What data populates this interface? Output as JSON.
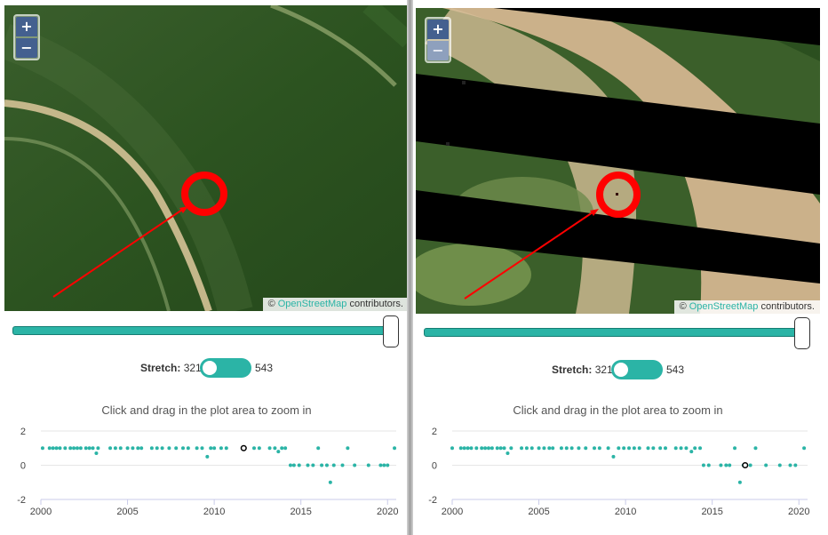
{
  "panels": [
    {
      "id": "left",
      "zoom_in": "+",
      "zoom_out": "−",
      "attribution": {
        "prefix": "© ",
        "link": "OpenStreetMap",
        "suffix": " contributors."
      },
      "stretch": {
        "label": "Stretch:",
        "min": "321",
        "max": "543"
      },
      "plot_title": "Click and drag in the plot area to zoom in",
      "chart_data": {
        "type": "scatter",
        "title": "",
        "xlabel": "",
        "ylabel": "",
        "xlim": [
          2000,
          2020.5
        ],
        "ylim": [
          -2,
          2
        ],
        "xticks": [
          "2000",
          "2005",
          "2010",
          "2015",
          "2020"
        ],
        "yticks": [
          "2",
          "0",
          "-2"
        ],
        "series": [
          {
            "color": "#2bb4a6",
            "points": [
              [
                2000.1,
                1
              ],
              [
                2000.5,
                1
              ],
              [
                2000.7,
                1
              ],
              [
                2000.9,
                1
              ],
              [
                2001.1,
                1
              ],
              [
                2001.4,
                1
              ],
              [
                2001.7,
                1
              ],
              [
                2001.9,
                1
              ],
              [
                2002.1,
                1
              ],
              [
                2002.3,
                1
              ],
              [
                2002.6,
                1
              ],
              [
                2002.8,
                1
              ],
              [
                2003.0,
                1
              ],
              [
                2003.2,
                0.7
              ],
              [
                2003.3,
                1
              ],
              [
                2004.0,
                1
              ],
              [
                2004.3,
                1
              ],
              [
                2004.6,
                1
              ],
              [
                2005.0,
                1
              ],
              [
                2005.3,
                1
              ],
              [
                2005.6,
                1
              ],
              [
                2005.8,
                1
              ],
              [
                2006.4,
                1
              ],
              [
                2006.7,
                1
              ],
              [
                2007.0,
                1
              ],
              [
                2007.4,
                1
              ],
              [
                2007.8,
                1
              ],
              [
                2008.2,
                1
              ],
              [
                2008.5,
                1
              ],
              [
                2009.0,
                1
              ],
              [
                2009.3,
                1
              ],
              [
                2009.6,
                0.5
              ],
              [
                2009.8,
                1
              ],
              [
                2010.0,
                1
              ],
              [
                2010.4,
                1
              ],
              [
                2010.7,
                1
              ],
              [
                2012.3,
                1
              ],
              [
                2012.6,
                1
              ],
              [
                2013.2,
                1
              ],
              [
                2013.5,
                1
              ],
              [
                2013.7,
                0.8
              ],
              [
                2013.9,
                1
              ],
              [
                2014.1,
                1
              ],
              [
                2014.4,
                0
              ],
              [
                2014.6,
                0
              ],
              [
                2014.9,
                0
              ],
              [
                2015.4,
                0
              ],
              [
                2015.7,
                0
              ],
              [
                2016.0,
                1
              ],
              [
                2016.2,
                0
              ],
              [
                2016.5,
                0
              ],
              [
                2016.7,
                -1
              ],
              [
                2016.9,
                0
              ],
              [
                2017.4,
                0
              ],
              [
                2017.7,
                1
              ],
              [
                2018.1,
                0
              ],
              [
                2018.9,
                0
              ],
              [
                2019.6,
                0
              ],
              [
                2019.8,
                0
              ],
              [
                2020.0,
                0
              ],
              [
                2020.4,
                1
              ]
            ]
          }
        ],
        "highlighted_point": [
          2011.7,
          1
        ]
      }
    },
    {
      "id": "right",
      "zoom_in": "+",
      "zoom_out": "−",
      "attribution": {
        "prefix": "© ",
        "link": "OpenStreetMap",
        "suffix": " contributors."
      },
      "stretch": {
        "label": "Stretch:",
        "min": "321",
        "max": "543"
      },
      "plot_title": "Click and drag in the plot area to zoom in",
      "chart_data": {
        "type": "scatter",
        "title": "",
        "xlabel": "",
        "ylabel": "",
        "xlim": [
          2000,
          2020.5
        ],
        "ylim": [
          -2,
          2
        ],
        "xticks": [
          "2000",
          "2005",
          "2010",
          "2015",
          "2020"
        ],
        "yticks": [
          "2",
          "0",
          "-2"
        ],
        "series": [
          {
            "color": "#2bb4a6",
            "points": [
              [
                2000.0,
                1
              ],
              [
                2000.5,
                1
              ],
              [
                2000.7,
                1
              ],
              [
                2000.9,
                1
              ],
              [
                2001.1,
                1
              ],
              [
                2001.4,
                1
              ],
              [
                2001.7,
                1
              ],
              [
                2001.9,
                1
              ],
              [
                2002.1,
                1
              ],
              [
                2002.3,
                1
              ],
              [
                2002.6,
                1
              ],
              [
                2002.8,
                1
              ],
              [
                2003.0,
                1
              ],
              [
                2003.2,
                0.7
              ],
              [
                2003.4,
                1
              ],
              [
                2004.0,
                1
              ],
              [
                2004.3,
                1
              ],
              [
                2004.6,
                1
              ],
              [
                2005.0,
                1
              ],
              [
                2005.3,
                1
              ],
              [
                2005.6,
                1
              ],
              [
                2005.8,
                1
              ],
              [
                2006.3,
                1
              ],
              [
                2006.6,
                1
              ],
              [
                2006.9,
                1
              ],
              [
                2007.3,
                1
              ],
              [
                2007.7,
                1
              ],
              [
                2008.2,
                1
              ],
              [
                2008.5,
                1
              ],
              [
                2009.0,
                1
              ],
              [
                2009.3,
                0.5
              ],
              [
                2009.6,
                1
              ],
              [
                2009.9,
                1
              ],
              [
                2010.2,
                1
              ],
              [
                2010.5,
                1
              ],
              [
                2010.8,
                1
              ],
              [
                2011.3,
                1
              ],
              [
                2011.6,
                1
              ],
              [
                2012.0,
                1
              ],
              [
                2012.3,
                1
              ],
              [
                2012.9,
                1
              ],
              [
                2013.2,
                1
              ],
              [
                2013.5,
                1
              ],
              [
                2013.8,
                0.8
              ],
              [
                2014.0,
                1
              ],
              [
                2014.3,
                1
              ],
              [
                2014.5,
                0
              ],
              [
                2014.8,
                0
              ],
              [
                2015.5,
                0
              ],
              [
                2015.8,
                0
              ],
              [
                2016.0,
                0
              ],
              [
                2016.3,
                1
              ],
              [
                2016.6,
                -1
              ],
              [
                2016.8,
                0
              ],
              [
                2017.2,
                0
              ],
              [
                2017.5,
                1
              ],
              [
                2018.1,
                0
              ],
              [
                2018.9,
                0
              ],
              [
                2019.5,
                0
              ],
              [
                2019.8,
                0
              ],
              [
                2020.3,
                1
              ]
            ]
          }
        ],
        "highlighted_point": [
          2016.9,
          0
        ]
      }
    }
  ]
}
